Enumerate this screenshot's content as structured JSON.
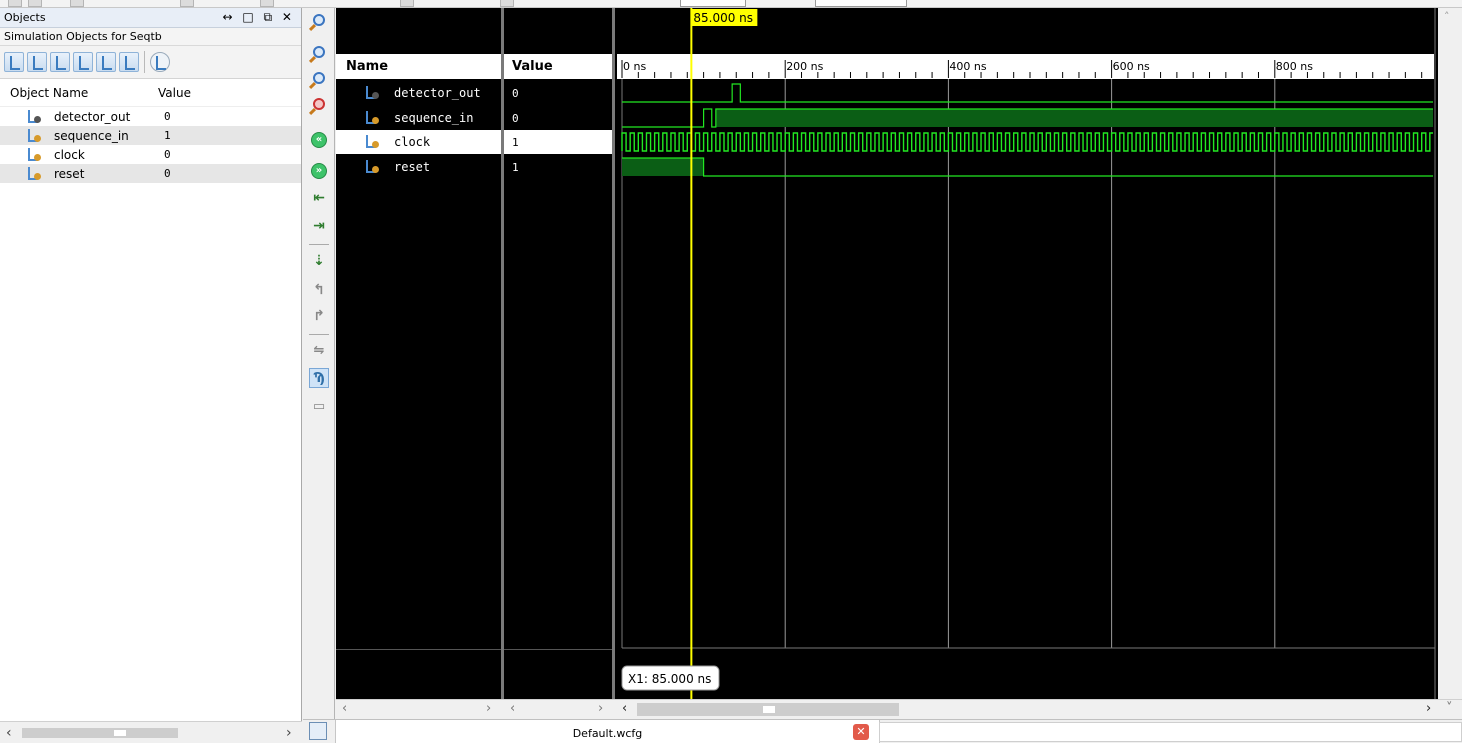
{
  "objects_panel": {
    "title": "Objects",
    "window_controls": "↔ □ ⧉ ✕",
    "subtitle": "Simulation Objects for Seqtb",
    "columns": {
      "name": "Object Name",
      "value": "Value"
    },
    "rows": [
      {
        "name": "detector_out",
        "value": "0"
      },
      {
        "name": "sequence_in",
        "value": "1"
      },
      {
        "name": "clock",
        "value": "0"
      },
      {
        "name": "reset",
        "value": "0"
      }
    ]
  },
  "wave_window": {
    "name_header": "Name",
    "value_header": "Value",
    "signals": [
      {
        "name": "detector_out",
        "value": "0"
      },
      {
        "name": "sequence_in",
        "value": "0"
      },
      {
        "name": "clock",
        "value": "1"
      },
      {
        "name": "reset",
        "value": "1"
      }
    ],
    "cursor_time_label": "85.000 ns",
    "cursor_readout": "X1: 85.000 ns",
    "time_ticks": [
      "0 ns",
      "200 ns",
      "400 ns",
      "600 ns",
      "800 ns"
    ],
    "time_range_ns": [
      0,
      1000
    ],
    "cursor_ns": 85
  },
  "waveforms": {
    "detector_out": {
      "pulses_ns": [
        [
          135,
          145
        ]
      ]
    },
    "sequence_in": {
      "high_from_ns": 115,
      "pulse_ns": [
        [
          100,
          110
        ]
      ]
    },
    "clock": {
      "period_ns": 10
    },
    "reset": {
      "high_until_ns": 100
    }
  },
  "colors": {
    "wave": "#22e822",
    "wave_fill": "#0b5e15",
    "cursor": "#ffff00",
    "grid": "#9a9a9a",
    "background": "#000000"
  },
  "tab": {
    "label": "Default.wcfg",
    "close": "✕"
  },
  "icons": {
    "zoom_in": "zoom-in-icon",
    "zoom_out": "zoom-out-icon",
    "zoom_fit": "zoom-fit-icon",
    "zoom_cursor": "zoom-to-cursor-icon",
    "go_start": "go-to-start-icon",
    "go_end": "go-to-end-icon",
    "prev_transition": "previous-transition-icon",
    "next_transition": "next-transition-icon",
    "add_marker": "add-marker-icon",
    "prev_marker": "previous-marker-icon",
    "next_marker": "next-marker-icon",
    "swap_cursors": "swap-cursors-icon",
    "snap": "snap-to-transition-icon",
    "floating_ruler": "floating-ruler-icon"
  }
}
